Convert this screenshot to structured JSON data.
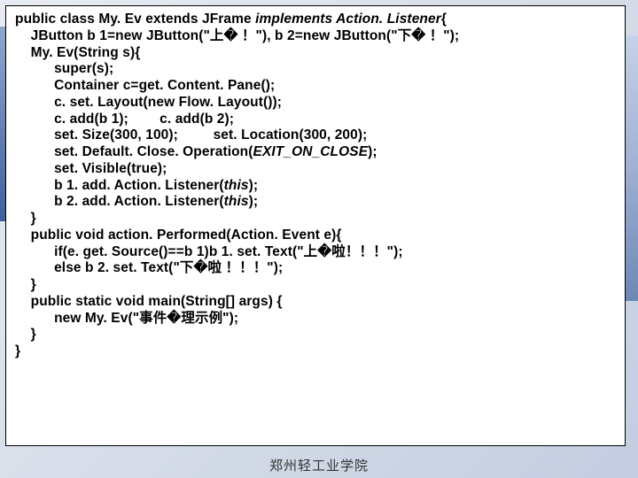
{
  "code": {
    "l1a": "public class My. Ev extends JFrame ",
    "l1b": "implements Action. Listener",
    "l1c": "{",
    "l2": "    JButton b 1=new JButton(\"上� ！\"), b 2=new JButton(\"下� ！\");",
    "l3": "    My. Ev(String s){",
    "l4": "          super(s);",
    "l5": "          Container c=get. Content. Pane();",
    "l6": "          c. set. Layout(new Flow. Layout());",
    "l7": "          c. add(b 1);        c. add(b 2);",
    "l8": "          set. Size(300, 100);         set. Location(300, 200);",
    "l9a": "          set. Default. Close. Operation(",
    "l9b": "EXIT_ON_CLOSE",
    "l9c": ");",
    "l10": "          set. Visible(true);",
    "l11a": "          b 1. add. Action. Listener(",
    "l11b": "this",
    "l11c": ");",
    "l12a": "          b 2. add. Action. Listener(",
    "l12b": "this",
    "l12c": ");",
    "l13": "    }",
    "l14": "    public void action. Performed(Action. Event e){",
    "l15": "          if(e. get. Source()==b 1)b 1. set. Text(\"上�啦！！！\");",
    "l16": "          else b 2. set. Text(\"下�啦 ！！！\");",
    "l17": "    }",
    "l18": "    public static void main(String[] args) {",
    "l19": "          new My. Ev(\"事件�理示例\");",
    "l20": "    }",
    "l21": "}"
  },
  "footer": "郑州轻工业学院"
}
